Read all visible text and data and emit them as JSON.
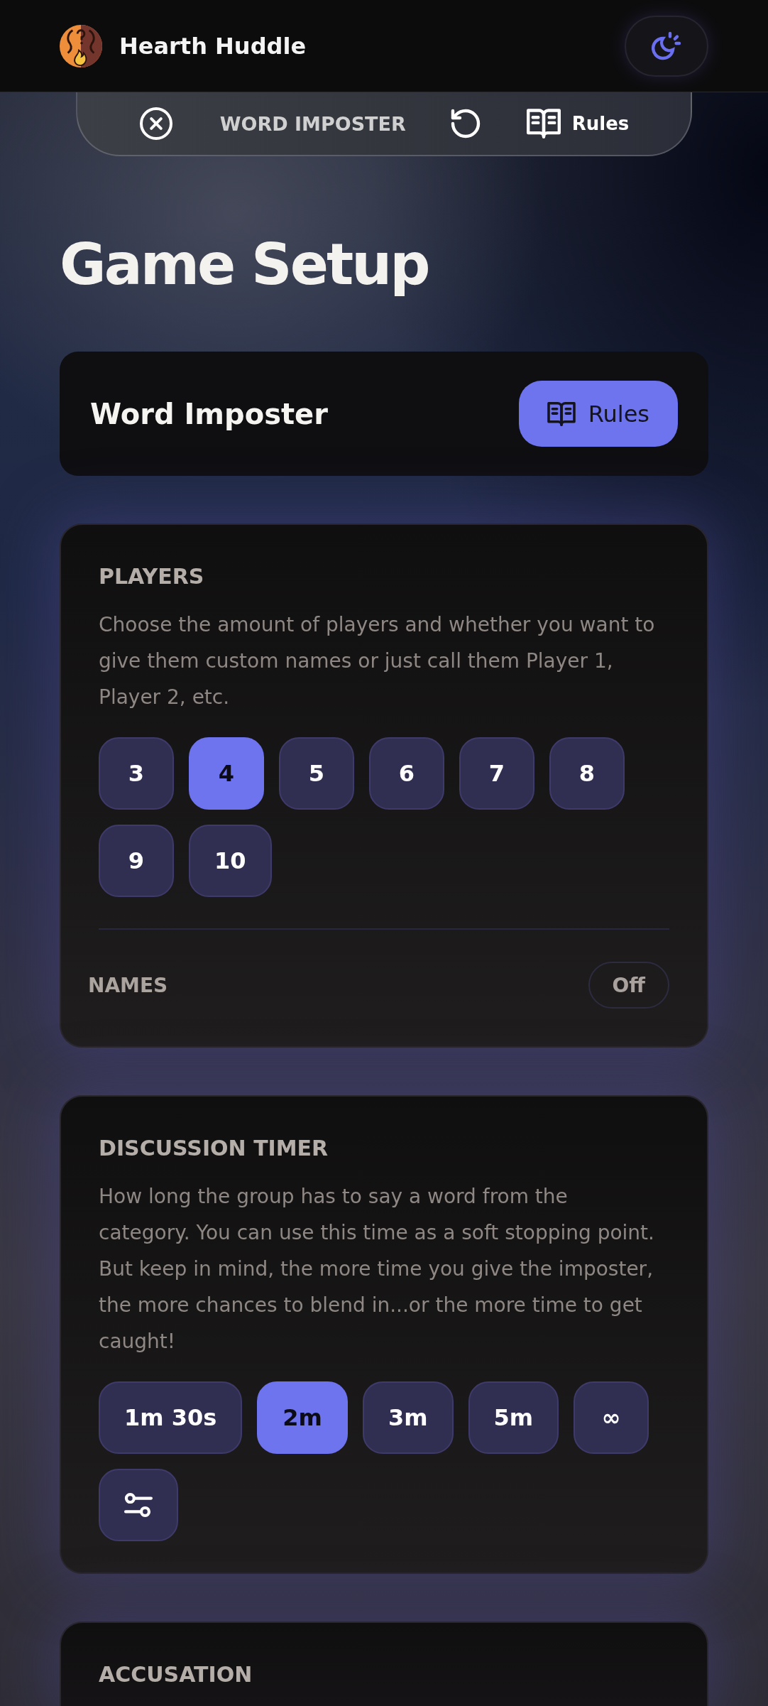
{
  "app_bar": {
    "title": "Hearth Huddle"
  },
  "game_bar": {
    "title": "WORD IMPOSTER",
    "rules": "Rules"
  },
  "page_title": "Game Setup",
  "game_card": {
    "name": "Word Imposter",
    "rules_button": "Rules"
  },
  "sections": [
    {
      "title": "PLAYERS",
      "description": "Choose the amount of players and whether you want to give them custom names or just call them Player 1, Player 2, etc.",
      "options": [
        {
          "kind": "text",
          "label": "3",
          "selected": false
        },
        {
          "kind": "text",
          "label": "4",
          "selected": true
        },
        {
          "kind": "text",
          "label": "5",
          "selected": false
        },
        {
          "kind": "text",
          "label": "6",
          "selected": false
        },
        {
          "kind": "text",
          "label": "7",
          "selected": false
        },
        {
          "kind": "text",
          "label": "8",
          "selected": false
        },
        {
          "kind": "text",
          "label": "9",
          "selected": false
        },
        {
          "kind": "text",
          "label": "10",
          "selected": false
        }
      ],
      "names": {
        "label": "NAMES",
        "value": "Off",
        "on": false
      }
    },
    {
      "title": "DISCUSSION TIMER",
      "description": "How long the group has to say a word from the category. You can use this time as a soft stopping point. But keep in mind, the more time you give the imposter, the more chances to blend in...or the more time to get caught!",
      "options": [
        {
          "kind": "text",
          "label": "1m 30s",
          "selected": false
        },
        {
          "kind": "text",
          "label": "2m",
          "selected": true
        },
        {
          "kind": "text",
          "label": "3m",
          "selected": false
        },
        {
          "kind": "text",
          "label": "5m",
          "selected": false
        },
        {
          "kind": "text",
          "label": "∞",
          "selected": false
        },
        {
          "kind": "custom",
          "selected": false
        }
      ]
    },
    {
      "title": "ACCUSATION"
    }
  ]
}
